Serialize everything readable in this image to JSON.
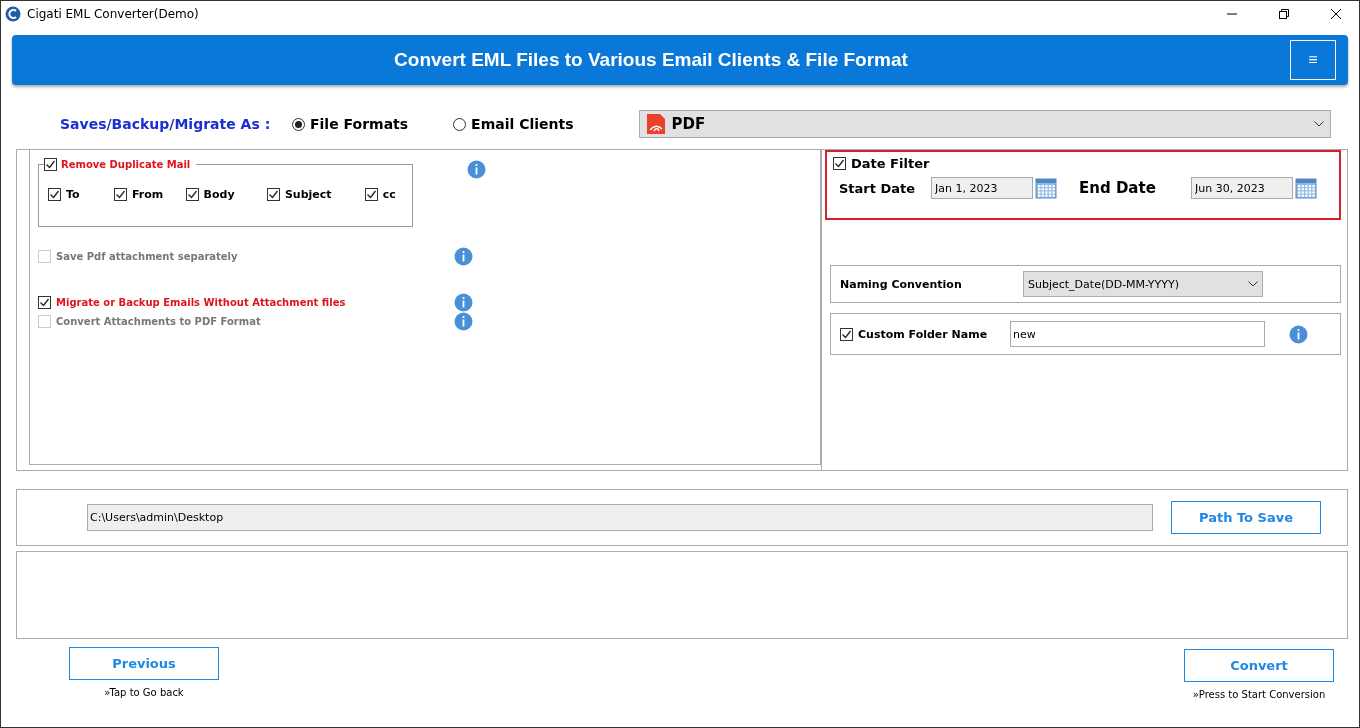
{
  "window": {
    "title": "Cigati EML Converter(Demo)"
  },
  "header": {
    "title": "Convert EML Files to Various Email Clients & File Format",
    "menu": "≡"
  },
  "saves": {
    "label": "Saves/Backup/Migrate As :",
    "options": [
      {
        "label": "File Formats",
        "selected": true
      },
      {
        "label": "Email Clients",
        "selected": false
      }
    ],
    "format": "PDF"
  },
  "duplicate": {
    "label": "Remove Duplicate Mail",
    "checked": true,
    "fields": [
      {
        "label": "To",
        "checked": true
      },
      {
        "label": "From",
        "checked": true
      },
      {
        "label": "Body",
        "checked": true
      },
      {
        "label": "Subject",
        "checked": true
      },
      {
        "label": "cc",
        "checked": true
      }
    ]
  },
  "options": [
    {
      "label": "Save Pdf attachment separately",
      "checked": false,
      "disabled": true
    },
    {
      "label": "Migrate or Backup Emails Without Attachment files",
      "checked": true,
      "disabled": false
    },
    {
      "label": "Convert Attachments to PDF Format",
      "checked": false,
      "disabled": true
    }
  ],
  "date_filter": {
    "label": "Date Filter",
    "checked": true,
    "start_label": "Start Date",
    "start_value": "Jan 1, 2023",
    "end_label": "End Date",
    "end_value": "Jun 30, 2023"
  },
  "naming": {
    "label": "Naming Convention",
    "value": "Subject_Date(DD-MM-YYYY)"
  },
  "custom_folder": {
    "label": "Custom Folder Name",
    "checked": true,
    "value": "new"
  },
  "path": {
    "value": "C:\\Users\\admin\\Desktop",
    "button": "Path To Save"
  },
  "previous": {
    "label": "Previous",
    "hint": "»Tap to Go back"
  },
  "convert": {
    "label": "Convert",
    "hint": "»Press to Start Conversion"
  }
}
